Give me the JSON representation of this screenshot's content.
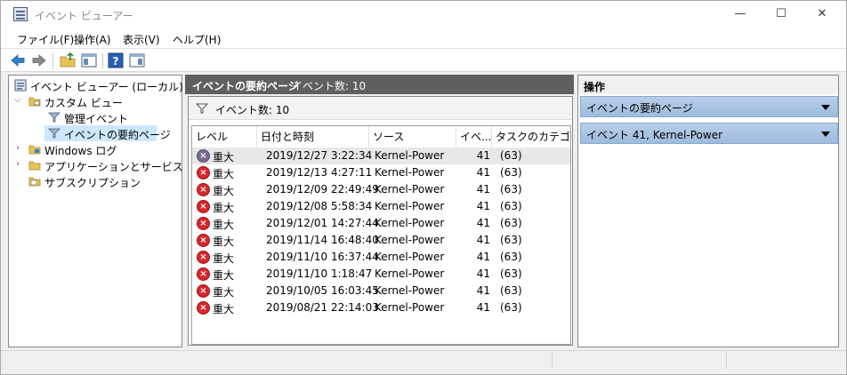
{
  "window": {
    "title": "イベント ビューアー",
    "controls": {
      "minimize": "—",
      "maximize": "☐",
      "close": "✕"
    }
  },
  "menu": [
    "ファイル(F)",
    "操作(A)",
    "表示(V)",
    "ヘルプ(H)"
  ],
  "toolbar": {
    "icons": [
      "back-arrow-icon",
      "forward-arrow-icon",
      "folder-up-icon",
      "show-tree-icon",
      "help-icon",
      "action-pane-icon"
    ]
  },
  "tree": {
    "items": [
      {
        "label": "イベント ビューアー (ローカル)",
        "icon": "event-viewer-icon"
      },
      {
        "label": "カスタム ビュー",
        "icon": "folder-icon"
      },
      {
        "label": "管理イベント",
        "icon": "filter-icon"
      },
      {
        "label": "イベントの要約ページ",
        "icon": "filter-icon"
      },
      {
        "label": "Windows ログ",
        "icon": "folder-icon"
      },
      {
        "label": "アプリケーションとサービス ログ",
        "icon": "folder-icon"
      },
      {
        "label": "サブスクリプション",
        "icon": "subscription-icon"
      }
    ],
    "selected_index": 3
  },
  "main": {
    "header_title": "イベントの要約ページ",
    "header_count": "イベント数: 10",
    "filter_label": "イベント数: 10",
    "columns": [
      "レベル",
      "日付と時刻",
      "ソース",
      "イベ...",
      "タスクのカテゴリ"
    ],
    "rows": [
      {
        "level": "重大",
        "datetime": "2019/12/27 3:22:34",
        "source": "Kernel-Power",
        "id": "41",
        "category": "(63)"
      },
      {
        "level": "重大",
        "datetime": "2019/12/13 4:27:11",
        "source": "Kernel-Power",
        "id": "41",
        "category": "(63)"
      },
      {
        "level": "重大",
        "datetime": "2019/12/09 22:49:49",
        "source": "Kernel-Power",
        "id": "41",
        "category": "(63)"
      },
      {
        "level": "重大",
        "datetime": "2019/12/08 5:58:34",
        "source": "Kernel-Power",
        "id": "41",
        "category": "(63)"
      },
      {
        "level": "重大",
        "datetime": "2019/12/01 14:27:44",
        "source": "Kernel-Power",
        "id": "41",
        "category": "(63)"
      },
      {
        "level": "重大",
        "datetime": "2019/11/14 16:48:40",
        "source": "Kernel-Power",
        "id": "41",
        "category": "(63)"
      },
      {
        "level": "重大",
        "datetime": "2019/11/10 16:37:44",
        "source": "Kernel-Power",
        "id": "41",
        "category": "(63)"
      },
      {
        "level": "重大",
        "datetime": "2019/11/10 1:18:47",
        "source": "Kernel-Power",
        "id": "41",
        "category": "(63)"
      },
      {
        "level": "重大",
        "datetime": "2019/10/05 16:03:45",
        "source": "Kernel-Power",
        "id": "41",
        "category": "(63)"
      },
      {
        "level": "重大",
        "datetime": "2019/08/21 22:14:03",
        "source": "Kernel-Power",
        "id": "41",
        "category": "(63)"
      }
    ],
    "selected_row": 0
  },
  "actions": {
    "title": "操作",
    "sections": [
      "イベントの要約ページ",
      "イベント 41, Kernel-Power"
    ]
  },
  "colors": {
    "header_bg": "#5f5f5f",
    "section_bg": "#9ebcdd",
    "tree_selected": "#cce8ff",
    "critical_icon": "#d7272a"
  }
}
